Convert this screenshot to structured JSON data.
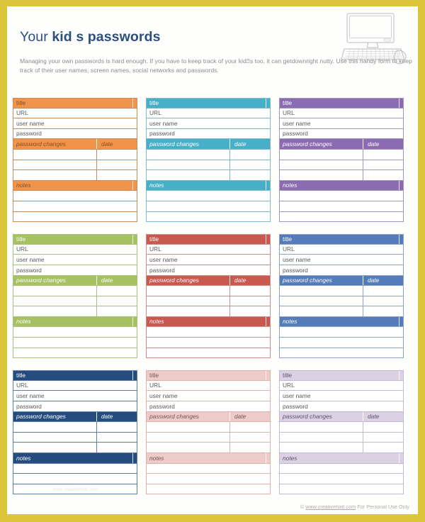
{
  "page": {
    "border_color": "#d9c537",
    "background": "#fefefd"
  },
  "header": {
    "title_light": "Your ",
    "title_bold": "kid s passwords",
    "title_color": "#2d4f7c",
    "intro": "Managing your own passwords is hard enough. If you have to keep track of your kid⍰s too, it can getdownright nutty. Use this handy form to keep track of their user names, screen names, social networks and passwords.",
    "illustration": "desktop-computer-keyboard-mouse"
  },
  "card_labels": {
    "title": "title",
    "url": "URL",
    "user_name": "user name",
    "password": "password",
    "password_changes": "password changes",
    "date": "date",
    "notes": "notes"
  },
  "cards": [
    {
      "name": "card-orange",
      "fill": "#f0944b",
      "line": "#c98a58",
      "ink": "#8a4d1d",
      "watermark": ""
    },
    {
      "name": "card-cyan",
      "fill": "#48afc9",
      "line": "#7fb9c9",
      "ink": "#ffffff",
      "watermark": ""
    },
    {
      "name": "card-purple",
      "fill": "#8b6cb3",
      "line": "#a494bd",
      "ink": "#ffffff",
      "watermark": ""
    },
    {
      "name": "card-green",
      "fill": "#a6c martin",
      "line": "#a9bf7e",
      "ink": "#ffffff",
      "watermark": ""
    },
    {
      "name": "card-red",
      "fill": "#c9584f",
      "line": "#c98f8a",
      "ink": "#ffffff",
      "watermark": ""
    },
    {
      "name": "card-blue",
      "fill": "#537cb8",
      "line": "#8aa3c4",
      "ink": "#ffffff",
      "watermark": ""
    },
    {
      "name": "card-navy",
      "fill": "#244c7e",
      "line": "#5d7ea6",
      "ink": "#ffffff",
      "watermark": "www.creativehatt.com"
    },
    {
      "name": "card-pink",
      "fill": "#eccbc8",
      "line": "#ddb3ae",
      "ink": "#7a5450",
      "watermark": ""
    },
    {
      "name": "card-lavender",
      "fill": "#dad2e4",
      "line": "#c3b9d1",
      "ink": "#5c5070",
      "watermark": ""
    }
  ],
  "footer": {
    "copyright_symbol": "© ",
    "site": "www.creativehatt.com",
    "rights": " For Personal Use Only"
  }
}
